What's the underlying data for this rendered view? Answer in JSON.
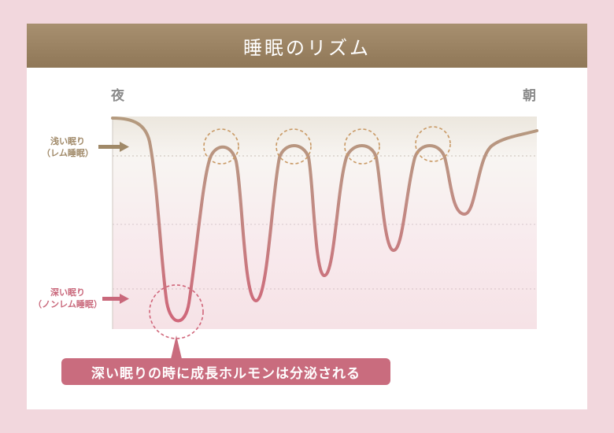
{
  "title": "睡眠のリズム",
  "axis": {
    "start": "夜",
    "end": "朝"
  },
  "states": {
    "light": {
      "line1": "浅い眠り",
      "line2": "（レム睡眠）"
    },
    "deep": {
      "line1": "深い眠り",
      "line2": "（ノンレム睡眠）"
    }
  },
  "callout": "深い眠りの時に成長ホルモンは分泌される",
  "colors": {
    "header": "#9a8262",
    "light_curve": "#b49a7e",
    "deep_curve": "#d0667a",
    "page_bg": "#f2d7dd",
    "callout": "#c96c7e"
  }
}
